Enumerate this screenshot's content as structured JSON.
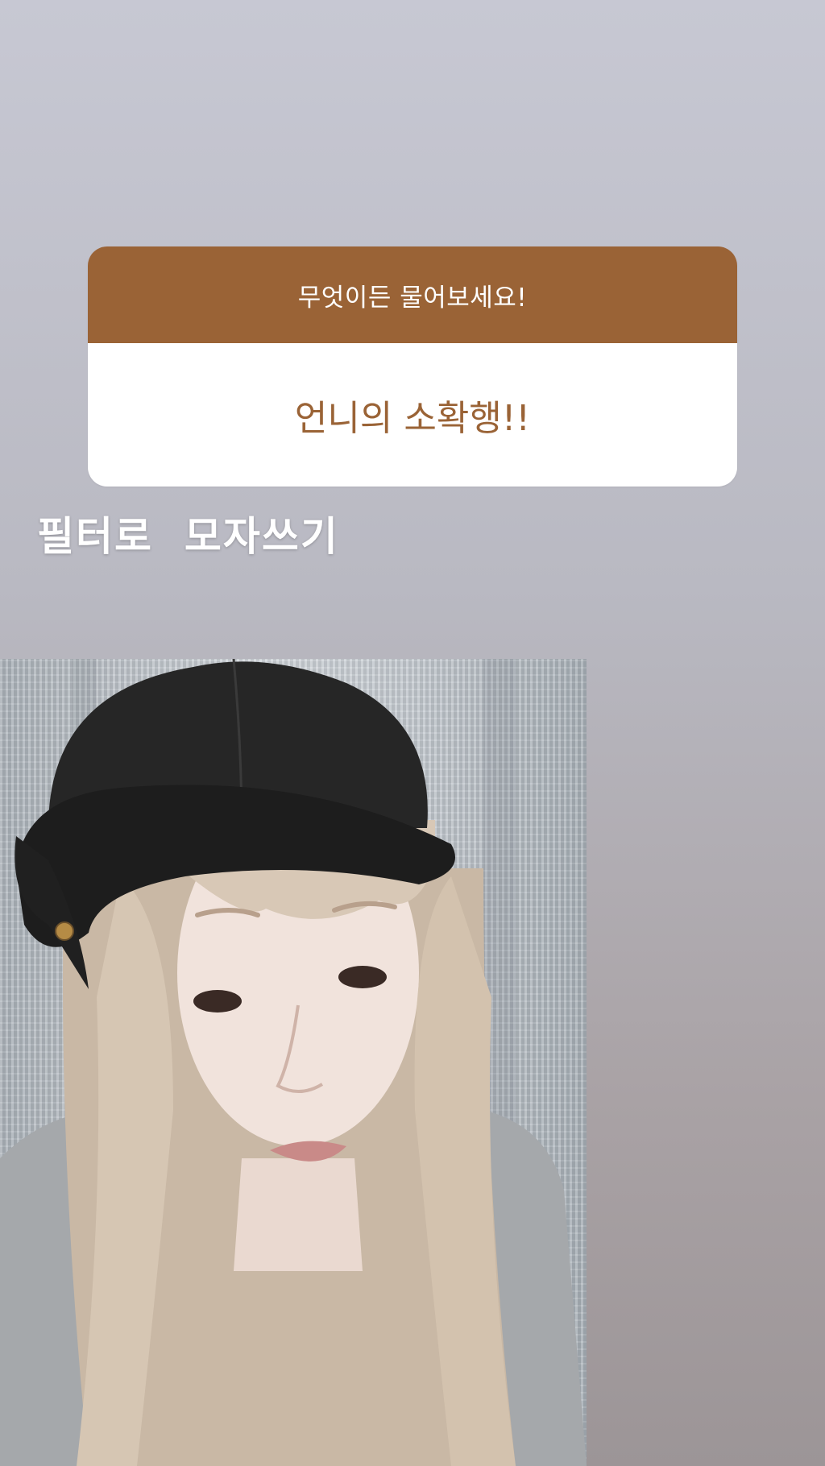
{
  "question_sticker": {
    "prompt": "무엇이든 물어보세요!",
    "answer": "언니의 소확행!!",
    "colors": {
      "header_background": "#9a6336",
      "answer_background": "#ffffff",
      "answer_text": "#9a6336"
    }
  },
  "caption": {
    "text": "필터로  모자쓰기"
  },
  "photo": {
    "subject": "selfie with black newsboy cap filter"
  }
}
